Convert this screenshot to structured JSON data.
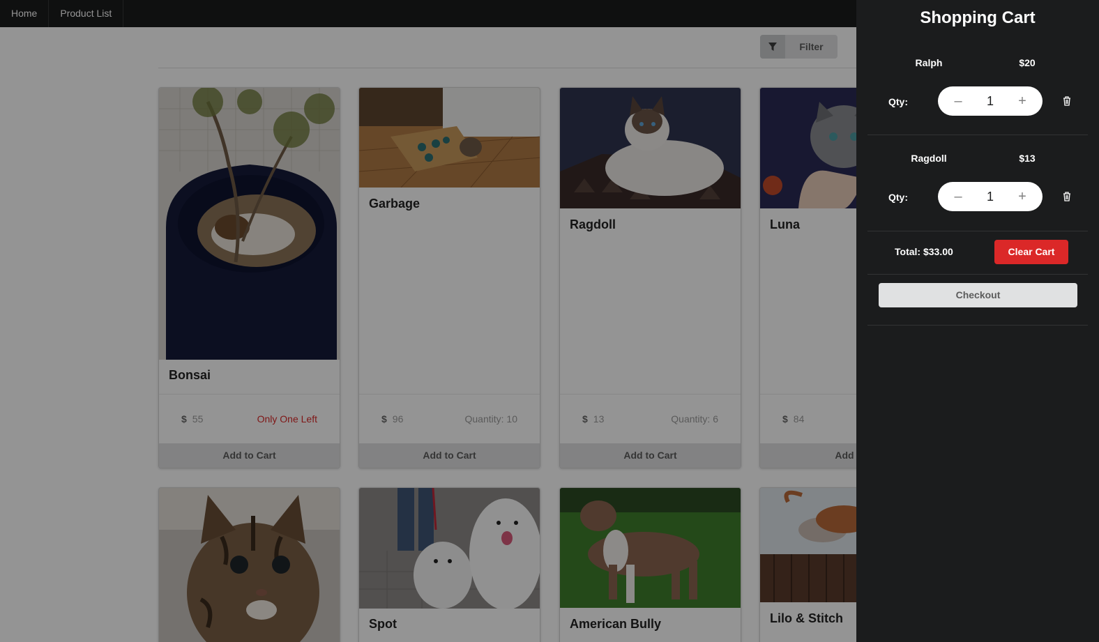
{
  "nav": {
    "items": [
      {
        "label": "Home"
      },
      {
        "label": "Product List"
      }
    ]
  },
  "toolbar": {
    "filter_label": "Filter",
    "filter_icon": "filter-icon"
  },
  "products": [
    {
      "name": "Bonsai",
      "price_symbol": "$",
      "price": "55",
      "stock": "Only One Left",
      "add_label": "Add to Cart"
    },
    {
      "name": "Garbage",
      "price_symbol": "$",
      "price": "96",
      "stock": "Quantity: 10",
      "add_label": "Add to Cart"
    },
    {
      "name": "Ragdoll",
      "price_symbol": "$",
      "price": "13",
      "stock": "Quantity: 6",
      "add_label": "Add to Cart"
    },
    {
      "name": "Luna",
      "price_symbol": "$",
      "price": "84",
      "stock": "",
      "add_label": "Add to"
    },
    {
      "name": "",
      "price_symbol": "",
      "price": "",
      "stock": "",
      "add_label": ""
    },
    {
      "name": "Spot",
      "price_symbol": "",
      "price": "",
      "stock": "",
      "add_label": ""
    },
    {
      "name": "American Bully",
      "price_symbol": "",
      "price": "",
      "stock": "",
      "add_label": ""
    },
    {
      "name": "Lilo & Stitch",
      "price_symbol": "",
      "price": "",
      "stock": "",
      "add_label": ""
    }
  ],
  "cart": {
    "title": "Shopping Cart",
    "qty_label": "Qty:",
    "items": [
      {
        "name": "Ralph",
        "price": "$20",
        "qty": "1"
      },
      {
        "name": "Ragdoll",
        "price": "$13",
        "qty": "1"
      }
    ],
    "total": "Total: $33.00",
    "clear_label": "Clear Cart",
    "checkout_label": "Checkout",
    "colors": {
      "clear": "#db2828",
      "background": "#1b1c1d"
    }
  }
}
